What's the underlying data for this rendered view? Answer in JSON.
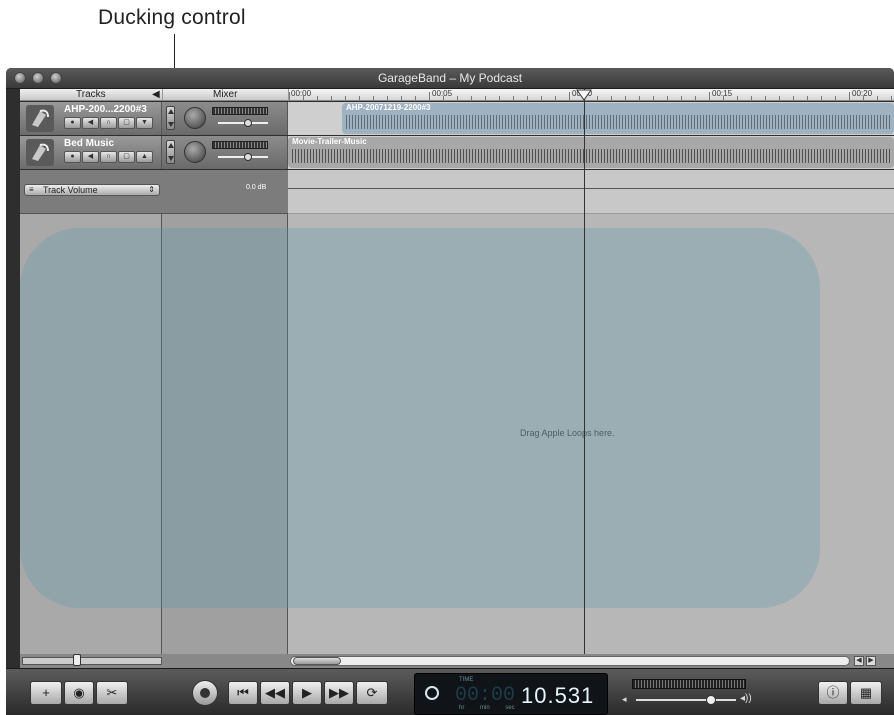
{
  "annotation": {
    "callout": "Ducking control"
  },
  "window": {
    "title": "GarageBand – My Podcast"
  },
  "headers": {
    "tracks": "Tracks",
    "mixer": "Mixer"
  },
  "ruler": {
    "labels": [
      "00:00",
      "00:05",
      "00:10",
      "00:15",
      "00:20"
    ]
  },
  "tracks": [
    {
      "name": "AHP-200...2200#3",
      "region_label": "AHP-20071219-2200#3"
    },
    {
      "name": "Bed Music",
      "region_label": "Movie-Trailer-Music"
    }
  ],
  "automation": {
    "parameter": "Track Volume",
    "db_value": "0.0 dB"
  },
  "timeline": {
    "empty_hint": "Drag Apple Loops here."
  },
  "lcd": {
    "label": "TIME",
    "hidden_digits": "00:00",
    "time": "10.531",
    "units": [
      "hr",
      "min",
      "sec"
    ]
  },
  "colors": {
    "region_voice": "#4c6f8c",
    "region_music": "#8d8d8d",
    "lcd_bg": "#101418",
    "accent_watermark": "#5496aa"
  },
  "icons": {
    "add": "plus-icon",
    "loops": "eye-icon",
    "editor": "scissors-icon",
    "info": "info-icon",
    "media": "media-browser-icon"
  }
}
